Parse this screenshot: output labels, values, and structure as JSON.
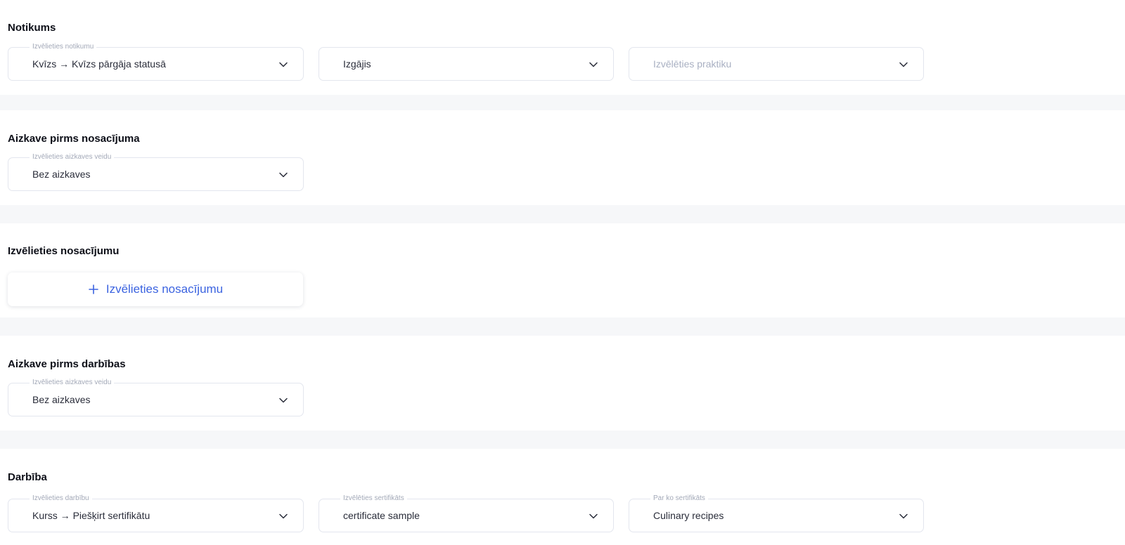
{
  "sections": {
    "event": {
      "title": "Notikums",
      "event_select": {
        "label": "Izvēlieties notikumu",
        "value": "Kvīzs → Kvīzs pārgāja statusā"
      },
      "status_select": {
        "label": "",
        "value": "Izgājis"
      },
      "practice_select": {
        "label": "",
        "placeholder": "Izvēlēties praktiku"
      }
    },
    "delay_before_condition": {
      "title": "Aizkave pirms nosacījuma",
      "delay_select": {
        "label": "Izvēlieties aizkaves veidu",
        "value": "Bez aizkaves"
      }
    },
    "condition": {
      "title": "Izvēlieties nosacījumu",
      "add_button_label": "Izvēlieties nosacījumu"
    },
    "delay_before_action": {
      "title": "Aizkave pirms darbības",
      "delay_select": {
        "label": "Izvēlieties aizkaves veidu",
        "value": "Bez aizkaves"
      }
    },
    "action": {
      "title": "Darbība",
      "action_select": {
        "label": "Izvēlieties darbību",
        "value": "Kurss → Piešķirt sertifikātu"
      },
      "certificate_select": {
        "label": "Izvēlēties sertifikāts",
        "value": "certificate sample"
      },
      "for_what_select": {
        "label": "Par ko sertifikāts",
        "value": "Culinary recipes"
      }
    }
  },
  "icons": {
    "dropdown": "chevron-down-icon",
    "add": "plus-icon"
  },
  "colors": {
    "accent": "#3b63e0",
    "page_background": "#f6f7f9",
    "panel_background": "#ffffff",
    "border": "#e3e6ee"
  }
}
